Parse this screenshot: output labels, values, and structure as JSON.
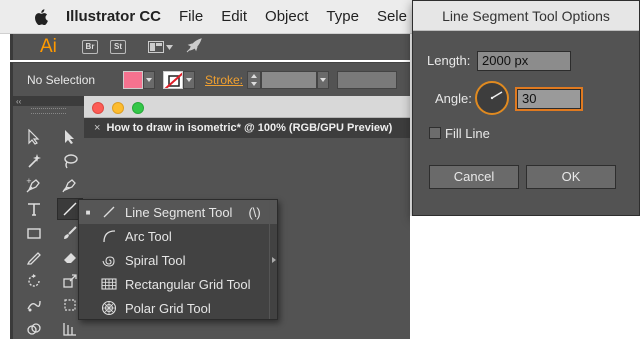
{
  "menubar": {
    "app_name": "Illustrator CC",
    "items": [
      "File",
      "Edit",
      "Object",
      "Type",
      "Sele"
    ]
  },
  "appbar": {
    "logo": "Ai",
    "bridge": "Br",
    "stock": "St"
  },
  "controlbar": {
    "selection": "No Selection",
    "stroke_label": "Stroke:",
    "fill_color": "#f5728f"
  },
  "panel": {
    "collapse": "‹‹"
  },
  "document": {
    "tab_close": "×",
    "tab_title": "How to draw in isometric* @ 100% (RGB/GPU Preview)"
  },
  "flyout": {
    "items": [
      {
        "label": "Line Segment Tool",
        "shortcut": "(\\)",
        "icon": "line-icon",
        "selected": true
      },
      {
        "label": "Arc Tool",
        "shortcut": "",
        "icon": "arc-icon",
        "selected": false
      },
      {
        "label": "Spiral Tool",
        "shortcut": "",
        "icon": "spiral-icon",
        "selected": false
      },
      {
        "label": "Rectangular Grid Tool",
        "shortcut": "",
        "icon": "rectangular-grid-icon",
        "selected": false
      },
      {
        "label": "Polar Grid Tool",
        "shortcut": "",
        "icon": "polar-grid-icon",
        "selected": false
      }
    ]
  },
  "dialog": {
    "title": "Line Segment Tool Options",
    "length_label": "Length:",
    "length_value": "2000 px",
    "angle_label": "Angle:",
    "angle_value": "30",
    "fill_line_label": "Fill Line",
    "fill_line_checked": false,
    "cancel_label": "Cancel",
    "ok_label": "OK"
  },
  "colors": {
    "accent": "#ff9a00",
    "focus": "#e07a20"
  }
}
